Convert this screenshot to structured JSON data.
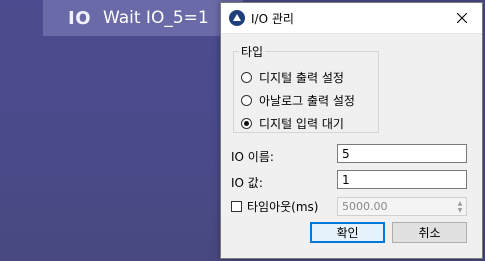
{
  "background": {
    "step_badge": "IO",
    "step_text": "Wait IO_5=1"
  },
  "dialog": {
    "title": "I/O 관리",
    "icons": {
      "app": "app-logo-icon",
      "close": "close-icon"
    },
    "type_group": {
      "legend": "타입",
      "options": [
        {
          "label": "디지털 출력 설정",
          "checked": false
        },
        {
          "label": "아날로그 출력 설정",
          "checked": false
        },
        {
          "label": "디지털 입력 대기",
          "checked": true
        }
      ]
    },
    "io_name": {
      "label": "IO 이름:",
      "value": "5"
    },
    "io_value": {
      "label": "IO 값:",
      "value": "1"
    },
    "timeout": {
      "label": "타임아웃(ms)",
      "checked": false,
      "value": "5000.00"
    },
    "buttons": {
      "ok": "확인",
      "cancel": "취소"
    }
  },
  "colors": {
    "desktop_bg": "#4a4a8c",
    "dialog_bg": "#f0f0f0",
    "primary_border": "#0078d7"
  }
}
